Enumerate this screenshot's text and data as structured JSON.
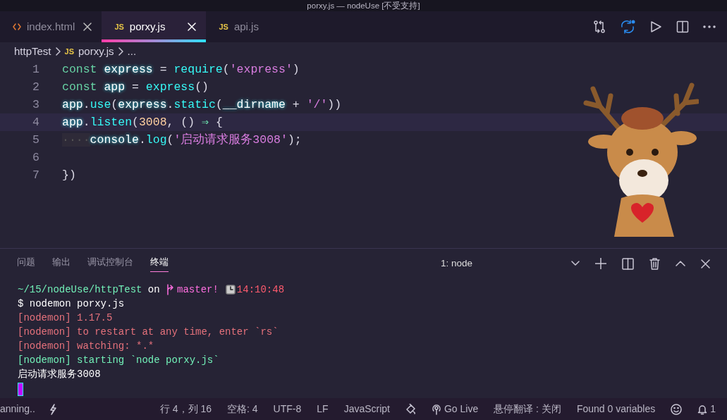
{
  "window": {
    "title": "porxy.js — nodeUse [不受支持]"
  },
  "editor_tabs": [
    {
      "label": "index.html",
      "kind": "html",
      "selected": false,
      "closable": true
    },
    {
      "label": "porxy.js",
      "kind": "js",
      "icon_text": "JS",
      "selected": true,
      "closable": true
    },
    {
      "label": "api.js",
      "kind": "js",
      "icon_text": "JS",
      "selected": false,
      "closable": false
    }
  ],
  "breadcrumb": [
    {
      "label": "httpTest"
    },
    {
      "label": "porxy.js",
      "icon_text": "JS"
    },
    {
      "label": "..."
    }
  ],
  "code_lines": [
    {
      "number": "1",
      "current": false,
      "tokens": [
        {
          "text": "const ",
          "kind": "keyword"
        },
        {
          "text": "express",
          "kind": "variable"
        },
        {
          "text": " = ",
          "kind": "punct"
        },
        {
          "text": "require",
          "kind": "function"
        },
        {
          "text": "(",
          "kind": "punct"
        },
        {
          "text": "'express'",
          "kind": "string"
        },
        {
          "text": ")",
          "kind": "punct"
        }
      ]
    },
    {
      "number": "2",
      "current": false,
      "tokens": [
        {
          "text": "const ",
          "kind": "keyword"
        },
        {
          "text": "app",
          "kind": "variable"
        },
        {
          "text": " = ",
          "kind": "punct"
        },
        {
          "text": "express",
          "kind": "function"
        },
        {
          "text": "()",
          "kind": "punct"
        }
      ]
    },
    {
      "number": "3",
      "current": false,
      "tokens": [
        {
          "text": "app",
          "kind": "variable"
        },
        {
          "text": ".",
          "kind": "punct"
        },
        {
          "text": "use",
          "kind": "function"
        },
        {
          "text": "(",
          "kind": "punct"
        },
        {
          "text": "express",
          "kind": "variable"
        },
        {
          "text": ".",
          "kind": "punct"
        },
        {
          "text": "static",
          "kind": "function"
        },
        {
          "text": "(",
          "kind": "punct"
        },
        {
          "text": "__dirname",
          "kind": "variable"
        },
        {
          "text": " + ",
          "kind": "punct"
        },
        {
          "text": "'/'",
          "kind": "string"
        },
        {
          "text": "))",
          "kind": "punct"
        }
      ]
    },
    {
      "number": "4",
      "current": true,
      "tokens": [
        {
          "text": "app",
          "kind": "variable"
        },
        {
          "text": ".",
          "kind": "punct"
        },
        {
          "text": "listen",
          "kind": "function"
        },
        {
          "text": "(",
          "kind": "punct"
        },
        {
          "text": "3008",
          "kind": "number"
        },
        {
          "text": ", () ",
          "kind": "punct"
        },
        {
          "text": "⇒",
          "kind": "arrow"
        },
        {
          "text": " {",
          "kind": "punct"
        }
      ]
    },
    {
      "number": "5",
      "current": false,
      "tokens": [
        {
          "text": "····",
          "kind": "whitespace"
        },
        {
          "text": "console",
          "kind": "variable"
        },
        {
          "text": ".",
          "kind": "punct"
        },
        {
          "text": "log",
          "kind": "function"
        },
        {
          "text": "(",
          "kind": "punct"
        },
        {
          "text": "'启动请求服务3008'",
          "kind": "string"
        },
        {
          "text": ");",
          "kind": "punct"
        }
      ]
    },
    {
      "number": "6",
      "current": false
    },
    {
      "number": "7",
      "current": false,
      "tokens": [
        {
          "text": "})",
          "kind": "punct"
        }
      ]
    }
  ],
  "panel": {
    "tabs": [
      {
        "label": "问题",
        "selected": false
      },
      {
        "label": "输出",
        "selected": false
      },
      {
        "label": "调试控制台",
        "selected": false
      },
      {
        "label": "终端",
        "selected": true
      }
    ],
    "terminal_select": "1: node",
    "terminal_lines": [
      [
        {
          "text": "~/15/nodeUse/httpTest",
          "kind": "path"
        },
        {
          "text": " on ",
          "kind": "plain"
        },
        {
          "text": "master!",
          "kind": "branch"
        },
        {
          "text": "14:10:48",
          "kind": "time"
        }
      ],
      [
        {
          "text": "$ nodemon porxy.js",
          "kind": "plain"
        }
      ],
      [
        {
          "text": "[nodemon] 1.17.5",
          "kind": "warn"
        }
      ],
      [
        {
          "text": "[nodemon] to restart at any time, enter `rs`",
          "kind": "warn"
        }
      ],
      [
        {
          "text": "[nodemon] watching: *.*",
          "kind": "warn"
        }
      ],
      [
        {
          "text": "[nodemon] starting `node porxy.js`",
          "kind": "info"
        }
      ],
      [
        {
          "text": "启动请求服务3008",
          "kind": "plain"
        }
      ]
    ]
  },
  "status_bar": {
    "left": [
      {
        "text": "anning..",
        "kind": "text"
      },
      {
        "kind": "bolt"
      }
    ],
    "right": [
      {
        "text": "行 4，列 16",
        "kind": "text"
      },
      {
        "text": "空格: 4",
        "kind": "text"
      },
      {
        "text": "UTF-8",
        "kind": "text"
      },
      {
        "text": "LF",
        "kind": "text"
      },
      {
        "text": "JavaScript",
        "kind": "text"
      },
      {
        "kind": "format"
      },
      {
        "text": "Go Live",
        "kind": "live"
      },
      {
        "text": "悬停翻译 : 关闭",
        "kind": "text"
      },
      {
        "text": "Found 0 variables",
        "kind": "text"
      },
      {
        "kind": "smiley"
      },
      {
        "text": "1",
        "kind": "bell"
      }
    ]
  }
}
